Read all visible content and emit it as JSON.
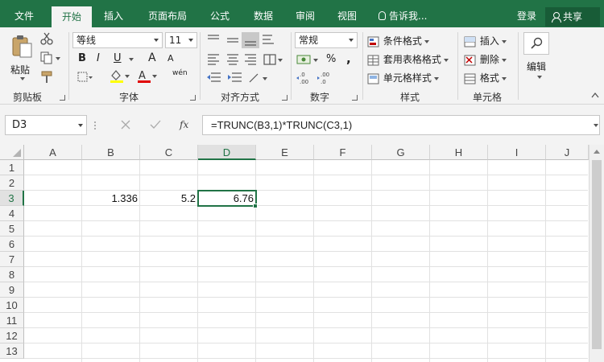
{
  "tabs": [
    {
      "label": "文件",
      "active": false
    },
    {
      "label": "开始",
      "active": true
    },
    {
      "label": "插入",
      "active": false
    },
    {
      "label": "页面布局",
      "active": false
    },
    {
      "label": "公式",
      "active": false
    },
    {
      "label": "数据",
      "active": false
    },
    {
      "label": "审阅",
      "active": false
    },
    {
      "label": "视图",
      "active": false
    }
  ],
  "tell_me": "告诉我...",
  "login": "登录",
  "share": "共享",
  "ribbon": {
    "clipboard": {
      "label": "剪贴板",
      "paste": "粘贴"
    },
    "font": {
      "label": "字体",
      "font_name": "等线",
      "font_size": "11",
      "bold": "B",
      "italic": "I",
      "underline": "U",
      "grow": "A",
      "shrink": "A",
      "phonetic": "wén"
    },
    "alignment": {
      "label": "对齐方式"
    },
    "number": {
      "label": "数字",
      "format": "常规",
      "percent": "%",
      "comma": ","
    },
    "styles": {
      "label": "样式",
      "conditional": "条件格式",
      "table": "套用表格格式",
      "cell_styles": "单元格样式"
    },
    "cells": {
      "label": "单元格",
      "insert": "插入",
      "delete": "删除",
      "format": "格式"
    },
    "editing": {
      "label": "编辑"
    }
  },
  "name_box": "D3",
  "formula": "=TRUNC(B3,1)*TRUNC(C3,1)",
  "columns": [
    "A",
    "B",
    "C",
    "D",
    "E",
    "F",
    "G",
    "H",
    "I",
    "J"
  ],
  "selected_column": "D",
  "rows": [
    "1",
    "2",
    "3",
    "4",
    "5",
    "6",
    "7",
    "8",
    "9",
    "10",
    "11",
    "12",
    "13"
  ],
  "selected_row": "3",
  "cells": {
    "B3": "1.336",
    "C3": "5.2",
    "D3": "6.76"
  },
  "colors": {
    "accent": "#217346",
    "font_color_bar": "#e00000",
    "highlight_bar": "#ffff00"
  }
}
